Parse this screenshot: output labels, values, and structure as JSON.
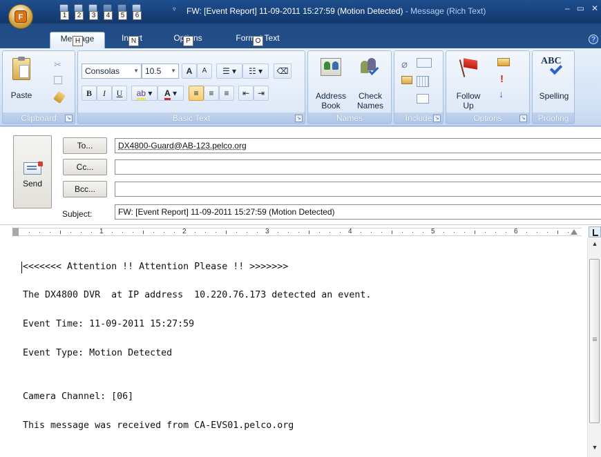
{
  "window": {
    "title": "FW: [Event Report] 11-09-2011 15:27:59 (Motion Detected)",
    "title_suffix": " - Message (Rich Text)",
    "orb_label": "F"
  },
  "quick_access": [
    {
      "icon": "save-icon",
      "key": "1"
    },
    {
      "icon": "undo-icon",
      "key": "2"
    },
    {
      "icon": "redo-icon",
      "key": "3"
    },
    {
      "icon": "up-arrow-icon",
      "key": "4"
    },
    {
      "icon": "down-arrow-icon",
      "key": "5"
    },
    {
      "icon": "customize-icon",
      "key": "6"
    }
  ],
  "tabs": [
    {
      "label": "Message",
      "key": "H",
      "active": true
    },
    {
      "label": "Insert",
      "key": "N",
      "active": false
    },
    {
      "label": "Options",
      "key": "P",
      "active": false
    },
    {
      "label": "Format Text",
      "key": "O",
      "active": false
    }
  ],
  "ribbon": {
    "clipboard": {
      "label": "Clipboard",
      "paste": "Paste"
    },
    "basic_text": {
      "label": "Basic Text",
      "font": "Consolas",
      "size": "10.5",
      "bold": "B",
      "italic": "I",
      "underline": "U",
      "grow": "A",
      "shrink": "A"
    },
    "names": {
      "label": "Names",
      "address_book": "Address\nBook",
      "check_names": "Check\nNames"
    },
    "include": {
      "label": "Include"
    },
    "options": {
      "label": "Options",
      "follow_up": "Follow\nUp"
    },
    "proofing": {
      "label": "Proofing",
      "spelling": "Spelling",
      "abc": "ABC"
    }
  },
  "header": {
    "send_label": "Send",
    "to_label": "To...",
    "cc_label": "Cc...",
    "bcc_label": "Bcc...",
    "subject_label": "Subject:",
    "to_value": "DX4800-Guard@AB-123.pelco.org",
    "cc_value": "",
    "bcc_value": "",
    "subject_value": "FW: [Event Report] 11-09-2011 15:27:59 (Motion Detected)"
  },
  "ruler": {
    "numbers": [
      "1",
      "2",
      "3",
      "4",
      "5",
      "6"
    ]
  },
  "body": {
    "lines": [
      "<<<<<<< Attention !! Attention Please !! >>>>>>>",
      "The DX4800 DVR  at IP address  10.220.76.173 detected an event.",
      "Event Time: 11-09-2011 15:27:59",
      "Event Type: Motion Detected",
      "Camera Channel: [06]",
      "This message was received from CA-EVS01.pelco.org"
    ]
  }
}
